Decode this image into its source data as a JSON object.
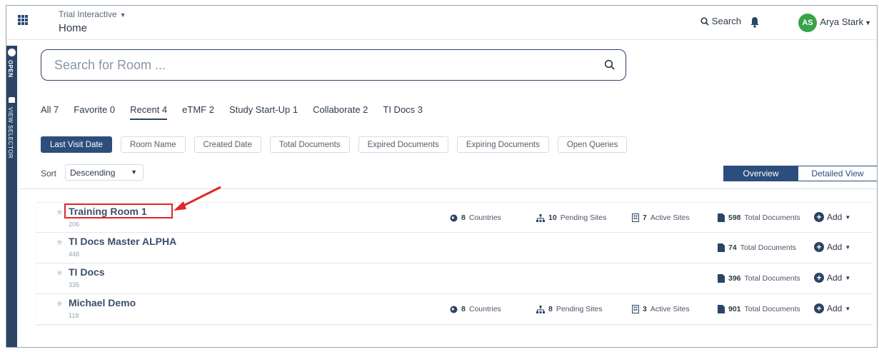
{
  "header": {
    "app_name": "Trial Interactive",
    "page_title": "Home",
    "search_label": "Search",
    "user_initials": "AS",
    "user_name": "Arya Stark"
  },
  "siderail": {
    "open_label": "OPEN",
    "view_selector_label": "VIEW SELECTOR"
  },
  "search": {
    "placeholder": "Search for Room ..."
  },
  "tabs": [
    {
      "label": "All 7",
      "active": false
    },
    {
      "label": "Favorite 0",
      "active": false
    },
    {
      "label": "Recent 4",
      "active": true
    },
    {
      "label": "eTMF 2",
      "active": false
    },
    {
      "label": "Study Start-Up 1",
      "active": false
    },
    {
      "label": "Collaborate 2",
      "active": false
    },
    {
      "label": "TI Docs 3",
      "active": false
    }
  ],
  "sort_pills": [
    {
      "label": "Last Visit Date",
      "active": true
    },
    {
      "label": "Room Name",
      "active": false
    },
    {
      "label": "Created Date",
      "active": false
    },
    {
      "label": "Total Documents",
      "active": false
    },
    {
      "label": "Expired Documents",
      "active": false
    },
    {
      "label": "Expiring Documents",
      "active": false
    },
    {
      "label": "Open Queries",
      "active": false
    }
  ],
  "sort": {
    "label": "Sort",
    "value": "Descending"
  },
  "view_toggle": {
    "overview": "Overview",
    "detailed": "Detailed View"
  },
  "rooms": [
    {
      "name": "Training Room 1",
      "id": "206",
      "countries": "8",
      "countries_label": "Countries",
      "pending_sites": "10",
      "pending_label": "Pending Sites",
      "active_sites": "7",
      "active_label": "Active Sites",
      "total_docs": "598",
      "docs_label": "Total Documents",
      "add_label": "Add"
    },
    {
      "name": "TI Docs Master ALPHA",
      "id": "448",
      "total_docs": "74",
      "docs_label": "Total Documents",
      "add_label": "Add"
    },
    {
      "name": "TI Docs",
      "id": "335",
      "total_docs": "396",
      "docs_label": "Total Documents",
      "add_label": "Add"
    },
    {
      "name": "Michael Demo",
      "id": "118",
      "countries": "8",
      "countries_label": "Countries",
      "pending_sites": "8",
      "pending_label": "Pending Sites",
      "active_sites": "3",
      "active_label": "Active Sites",
      "total_docs": "901",
      "docs_label": "Total Documents",
      "add_label": "Add"
    }
  ],
  "colors": {
    "primary": "#2c4e7c",
    "rail": "#2c4466",
    "avatar": "#3aa24b",
    "annotation": "#e02626"
  }
}
